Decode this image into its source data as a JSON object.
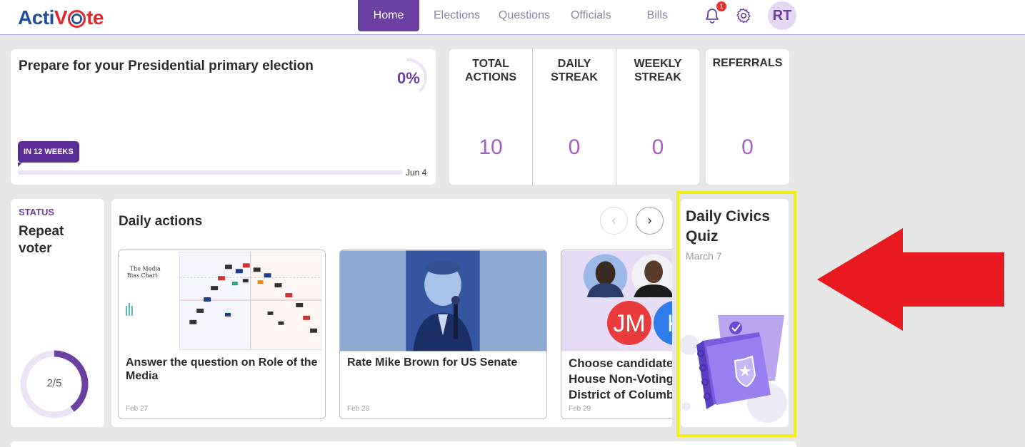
{
  "header": {
    "logo_left": "Acti",
    "logo_right": "te",
    "nav": [
      "Home",
      "Elections",
      "Questions",
      "Officials",
      "Bills"
    ],
    "notification_count": "1",
    "avatar_initials": "RT"
  },
  "election": {
    "title": "Prepare for your Presidential primary election",
    "percent": "0%",
    "progress_fraction": 0,
    "weeks_tag": "IN 12 WEEKS",
    "end_date": "Jun 4"
  },
  "stats": [
    {
      "label_line1": "TOTAL",
      "label_line2": "ACTIONS",
      "value": "10"
    },
    {
      "label_line1": "DAILY",
      "label_line2": "STREAK",
      "value": "0"
    },
    {
      "label_line1": "WEEKLY",
      "label_line2": "STREAK",
      "value": "0"
    }
  ],
  "referrals": {
    "label": "REFERRALS",
    "value": "0"
  },
  "status": {
    "label": "STATUS",
    "value": "Repeat voter",
    "progress_text": "2/5",
    "progress_fraction": 0.4
  },
  "daily_actions": {
    "title": "Daily actions",
    "items": [
      {
        "text": "Answer the question on Role of the Media",
        "date": "Feb 27",
        "image": "media-bias-chart",
        "image_text": [
          "The Media",
          "Bias Chart"
        ]
      },
      {
        "text": "Rate Mike Brown for US Senate",
        "date": "Feb 28",
        "image": "candidate-photo"
      },
      {
        "text_lines": [
          "Choose candidate",
          "House Non-Voting",
          "District of Columb"
        ],
        "date": "Feb 29",
        "image": "candidate-avatars",
        "initials": [
          "JM",
          "K"
        ]
      }
    ]
  },
  "quiz": {
    "title": "Daily Civics Quiz",
    "date": "March 7"
  },
  "colors": {
    "primary": "#6c3fa3",
    "accent_value": "#a45fc3",
    "highlight": "#f4ef1a",
    "arrow": "#e8191f"
  }
}
